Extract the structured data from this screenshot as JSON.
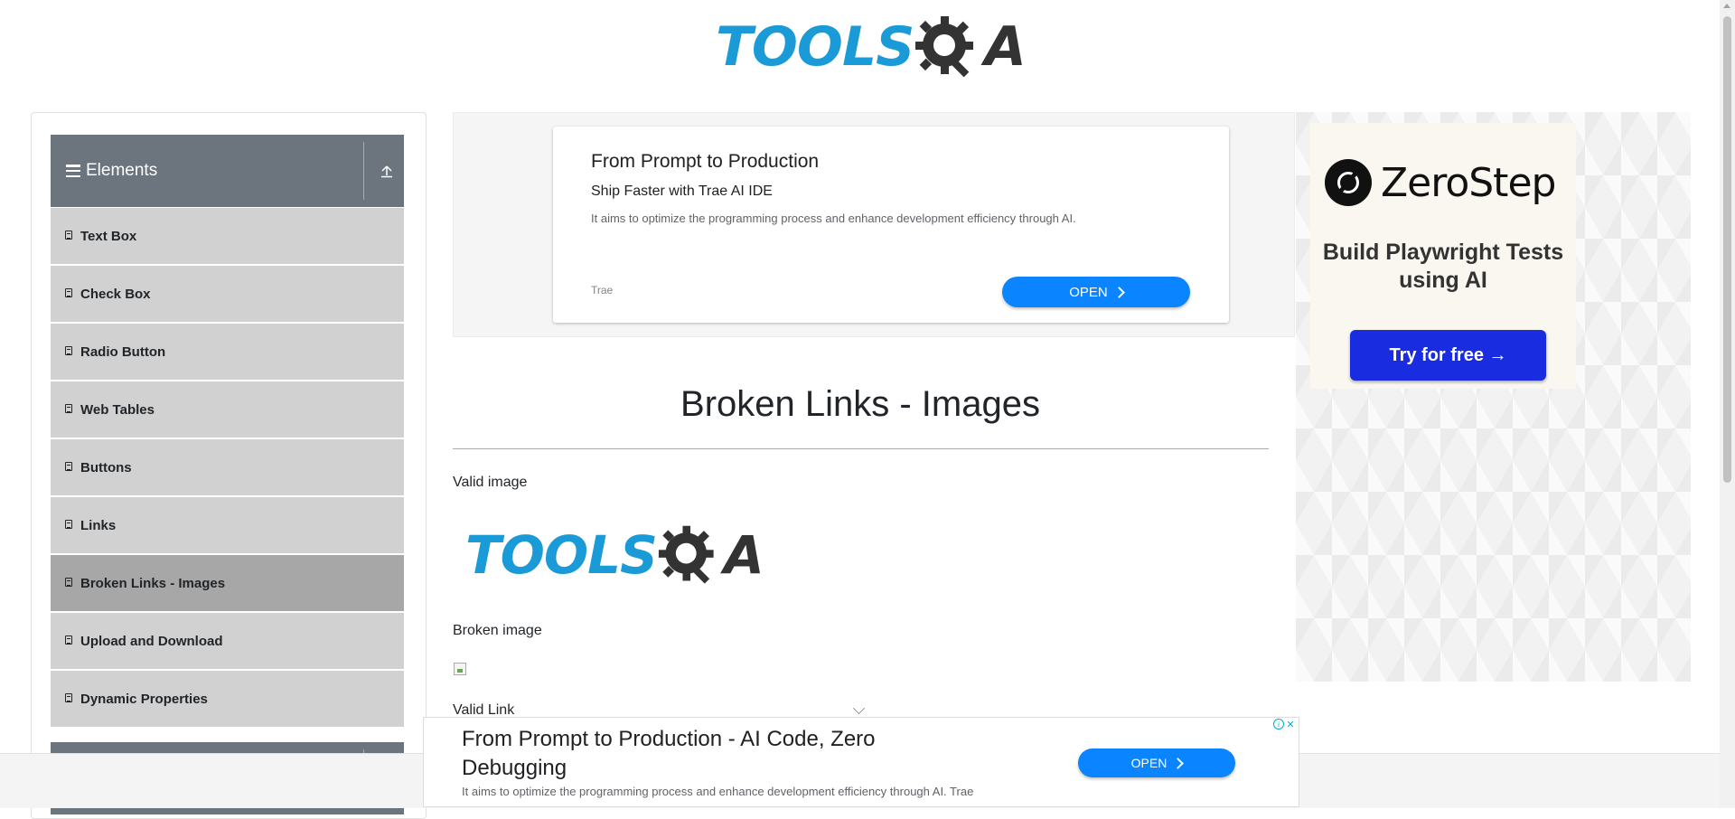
{
  "header": {
    "logo_tools": "TOOLS",
    "logo_qa": "A"
  },
  "sidebar": {
    "group_title": "Elements",
    "items": [
      {
        "label": "Text Box"
      },
      {
        "label": "Check Box"
      },
      {
        "label": "Radio Button"
      },
      {
        "label": "Web Tables"
      },
      {
        "label": "Buttons"
      },
      {
        "label": "Links"
      },
      {
        "label": "Broken Links - Images",
        "active": true
      },
      {
        "label": "Upload and Download"
      },
      {
        "label": "Dynamic Properties"
      }
    ]
  },
  "top_ad": {
    "title": "From Prompt to Production",
    "subtitle": "Ship Faster with Trae AI IDE",
    "description": "It aims to optimize the programming process and enhance development efficiency through AI.",
    "brand": "Trae",
    "button": "OPEN"
  },
  "main": {
    "page_title": "Broken Links - Images",
    "valid_image_label": "Valid image",
    "broken_image_label": "Broken image",
    "valid_link_label": "Valid Link"
  },
  "right_ad": {
    "brand": "ZeroStep",
    "tagline": "Build Playwright Tests using AI",
    "button": "Try for free →"
  },
  "bottom_ad": {
    "title": "From Prompt to Production - AI Code, Zero Debugging",
    "description": "It aims to optimize the programming process and enhance development efficiency through AI. Trae",
    "button": "OPEN"
  },
  "colors": {
    "sidebar_header": "#6c757d",
    "menu_item": "#d1d1d1",
    "menu_item_active": "#a7a7a7",
    "ad_button": "#0a84ff",
    "zerostep_button": "#1a2ce0",
    "logo_blue": "#1a9ad6"
  }
}
